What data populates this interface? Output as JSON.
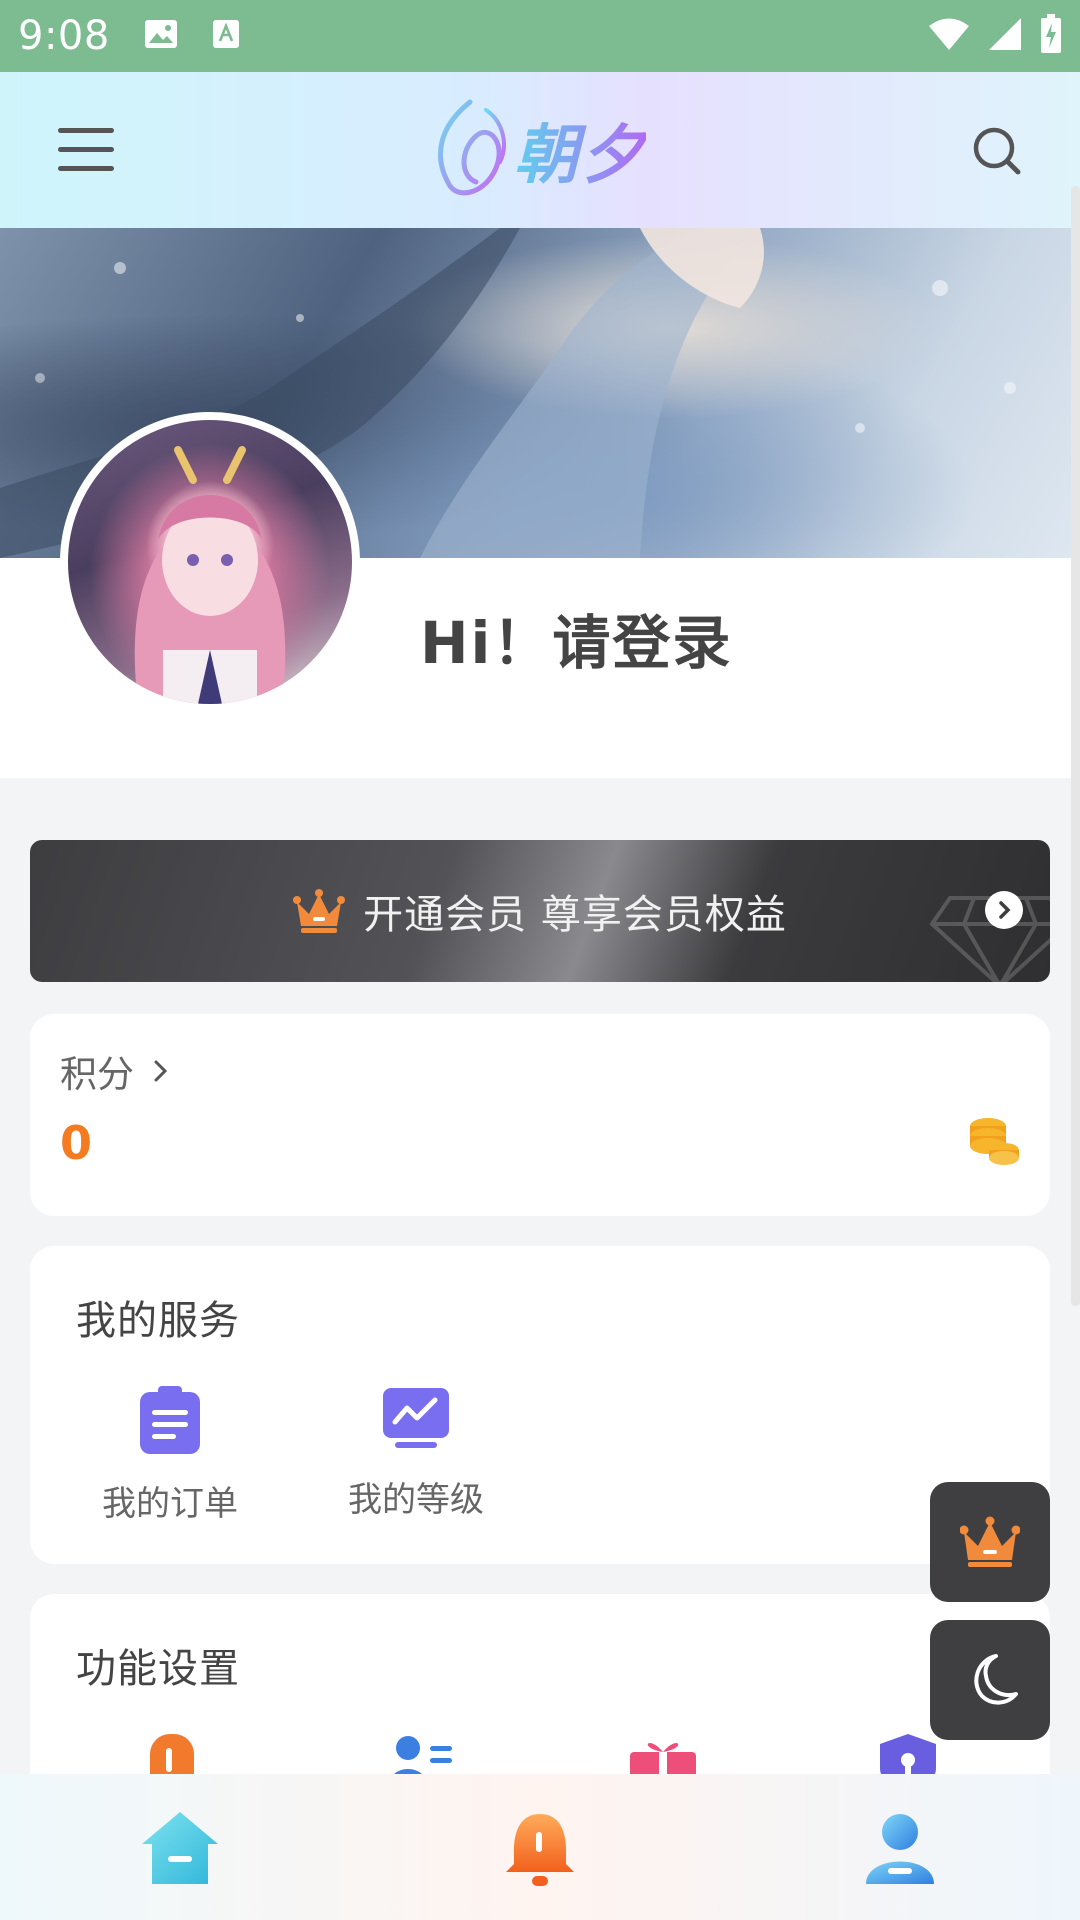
{
  "status_bar": {
    "time": "9:08"
  },
  "header": {
    "logo_text": "朝夕"
  },
  "profile": {
    "greeting": "Hi！请登录"
  },
  "vip": {
    "text": "开通会员 尊享会员权益"
  },
  "points": {
    "label": "积分",
    "value": "0"
  },
  "services": {
    "title": "我的服务",
    "items": [
      {
        "label": "我的订单",
        "icon": "clipboard-icon"
      },
      {
        "label": "我的等级",
        "icon": "level-chart-icon"
      }
    ]
  },
  "settings": {
    "title": "功能设置",
    "items": [
      {
        "icon": "orange-settings-icon"
      },
      {
        "icon": "user-list-icon"
      },
      {
        "icon": "gift-icon"
      },
      {
        "icon": "shield-lock-icon"
      }
    ]
  },
  "floating": {
    "items": [
      "crown-icon",
      "moon-icon"
    ]
  },
  "bottom_nav": {
    "items": [
      "home-icon",
      "bell-icon",
      "user-icon"
    ]
  },
  "colors": {
    "status_bar": "#7dbb91",
    "accent_orange": "#f47b1f",
    "vip_dark": "#3d3d40",
    "service_purple": "#7a6ef0"
  }
}
